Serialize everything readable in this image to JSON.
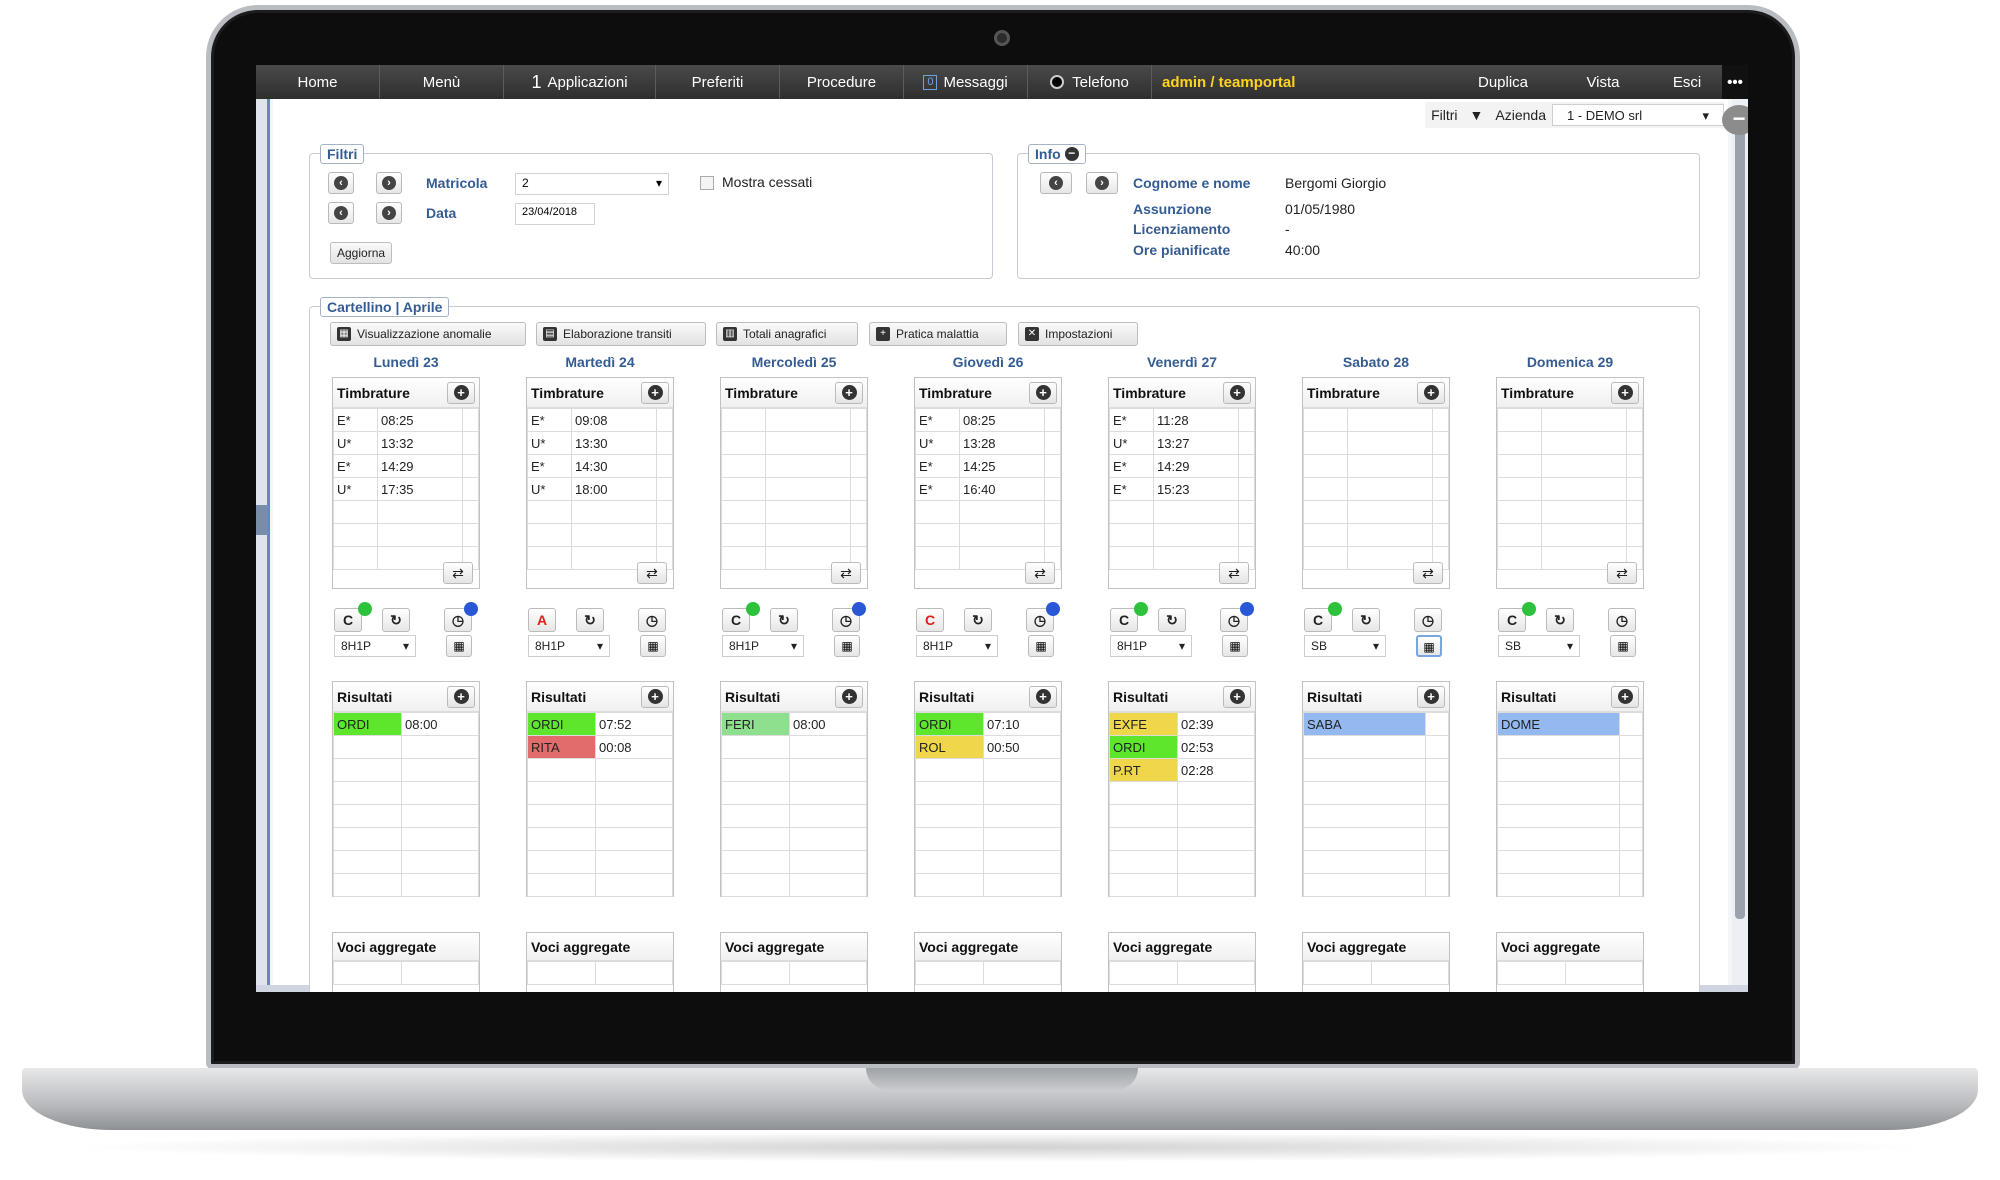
{
  "nav": {
    "home": "Home",
    "menu": "Menù",
    "apps_count": "1",
    "apps": "Applicazioni",
    "preferiti": "Preferiti",
    "procedure": "Procedure",
    "msg_count": "0",
    "messaggi": "Messaggi",
    "telefono": "Telefono",
    "user": "admin / teamportal",
    "duplica": "Duplica",
    "vista": "Vista",
    "esci": "Esci",
    "more": "•••"
  },
  "filterbar": {
    "filtri": "Filtri",
    "azienda_label": "Azienda",
    "azienda_value": "1 - DEMO srl"
  },
  "filtri": {
    "legend": "Filtri",
    "matricola_label": "Matricola",
    "matricola_value": "2",
    "data_label": "Data",
    "data_value": "23/04/2018",
    "mostra_cessati": "Mostra cessati",
    "aggiorna": "Aggiorna"
  },
  "info": {
    "legend": "Info",
    "cognome_label": "Cognome e nome",
    "cognome_value": "Bergomi Giorgio",
    "assunzione_label": "Assunzione",
    "assunzione_value": "01/05/1980",
    "licenziamento_label": "Licenziamento",
    "licenziamento_value": "-",
    "ore_label": "Ore pianificate",
    "ore_value": "40:00"
  },
  "cartellino": {
    "legend": "Cartellino | Aprile",
    "toolbar": [
      "Visualizzazione anomalie",
      "Elaborazione transiti",
      "Totali anagrafici",
      "Pratica malattia",
      "Impostazioni"
    ],
    "timbrature_title": "Timbrature",
    "risultati_title": "Risultati",
    "voci_title": "Voci aggregate"
  },
  "colors": {
    "green": "#5ee62c",
    "red": "#e06c6c",
    "lightgreen": "#8ee08e",
    "yellow": "#f0d64a",
    "blue": "#94b9f0",
    "dot_green": "#2ec23c",
    "dot_blue": "#2a57d6"
  },
  "days": [
    {
      "name": "Lunedì 23",
      "timbrature": [
        [
          "E*",
          "08:25"
        ],
        [
          "U*",
          "13:32"
        ],
        [
          "E*",
          "14:29"
        ],
        [
          "U*",
          "17:35"
        ]
      ],
      "code": "C",
      "code_red": false,
      "code_dot": "green",
      "clock_dot": "blue",
      "schedule": "8H1P",
      "risultati": [
        [
          "ORDI",
          "08:00",
          "green"
        ]
      ]
    },
    {
      "name": "Martedì 24",
      "timbrature": [
        [
          "E*",
          "09:08"
        ],
        [
          "U*",
          "13:30"
        ],
        [
          "E*",
          "14:30"
        ],
        [
          "U*",
          "18:00"
        ]
      ],
      "code": "A",
      "code_red": true,
      "code_dot": "",
      "clock_dot": "",
      "schedule": "8H1P",
      "risultati": [
        [
          "ORDI",
          "07:52",
          "green"
        ],
        [
          "RITA",
          "00:08",
          "red"
        ]
      ]
    },
    {
      "name": "Mercoledì 25",
      "timbrature": [],
      "code": "C",
      "code_red": false,
      "code_dot": "green",
      "clock_dot": "blue",
      "schedule": "8H1P",
      "risultati": [
        [
          "FERI",
          "08:00",
          "lightgreen"
        ]
      ]
    },
    {
      "name": "Giovedì 26",
      "timbrature": [
        [
          "E*",
          "08:25"
        ],
        [
          "U*",
          "13:28"
        ],
        [
          "E*",
          "14:25"
        ],
        [
          "E*",
          "16:40"
        ]
      ],
      "code": "C",
      "code_red": true,
      "code_dot": "",
      "clock_dot": "blue",
      "schedule": "8H1P",
      "risultati": [
        [
          "ORDI",
          "07:10",
          "green"
        ],
        [
          "ROL",
          "00:50",
          "yellow"
        ]
      ]
    },
    {
      "name": "Venerdì 27",
      "timbrature": [
        [
          "E*",
          "11:28"
        ],
        [
          "U*",
          "13:27"
        ],
        [
          "E*",
          "14:29"
        ],
        [
          "E*",
          "15:23"
        ]
      ],
      "code": "C",
      "code_red": false,
      "code_dot": "green",
      "clock_dot": "blue",
      "schedule": "8H1P",
      "risultati": [
        [
          "EXFE",
          "02:39",
          "yellow"
        ],
        [
          "ORDI",
          "02:53",
          "green"
        ],
        [
          "P.RT",
          "02:28",
          "yellow"
        ]
      ]
    },
    {
      "name": "Sabato 28",
      "timbrature": [],
      "code": "C",
      "code_red": false,
      "code_dot": "green",
      "clock_dot": "",
      "schedule": "SB",
      "risultati": [
        [
          "SABA",
          "",
          "blue"
        ]
      ]
    },
    {
      "name": "Domenica 29",
      "timbrature": [],
      "code": "C",
      "code_red": false,
      "code_dot": "green",
      "clock_dot": "",
      "schedule": "SB",
      "risultati": [
        [
          "DOME",
          "",
          "blue"
        ]
      ]
    }
  ]
}
